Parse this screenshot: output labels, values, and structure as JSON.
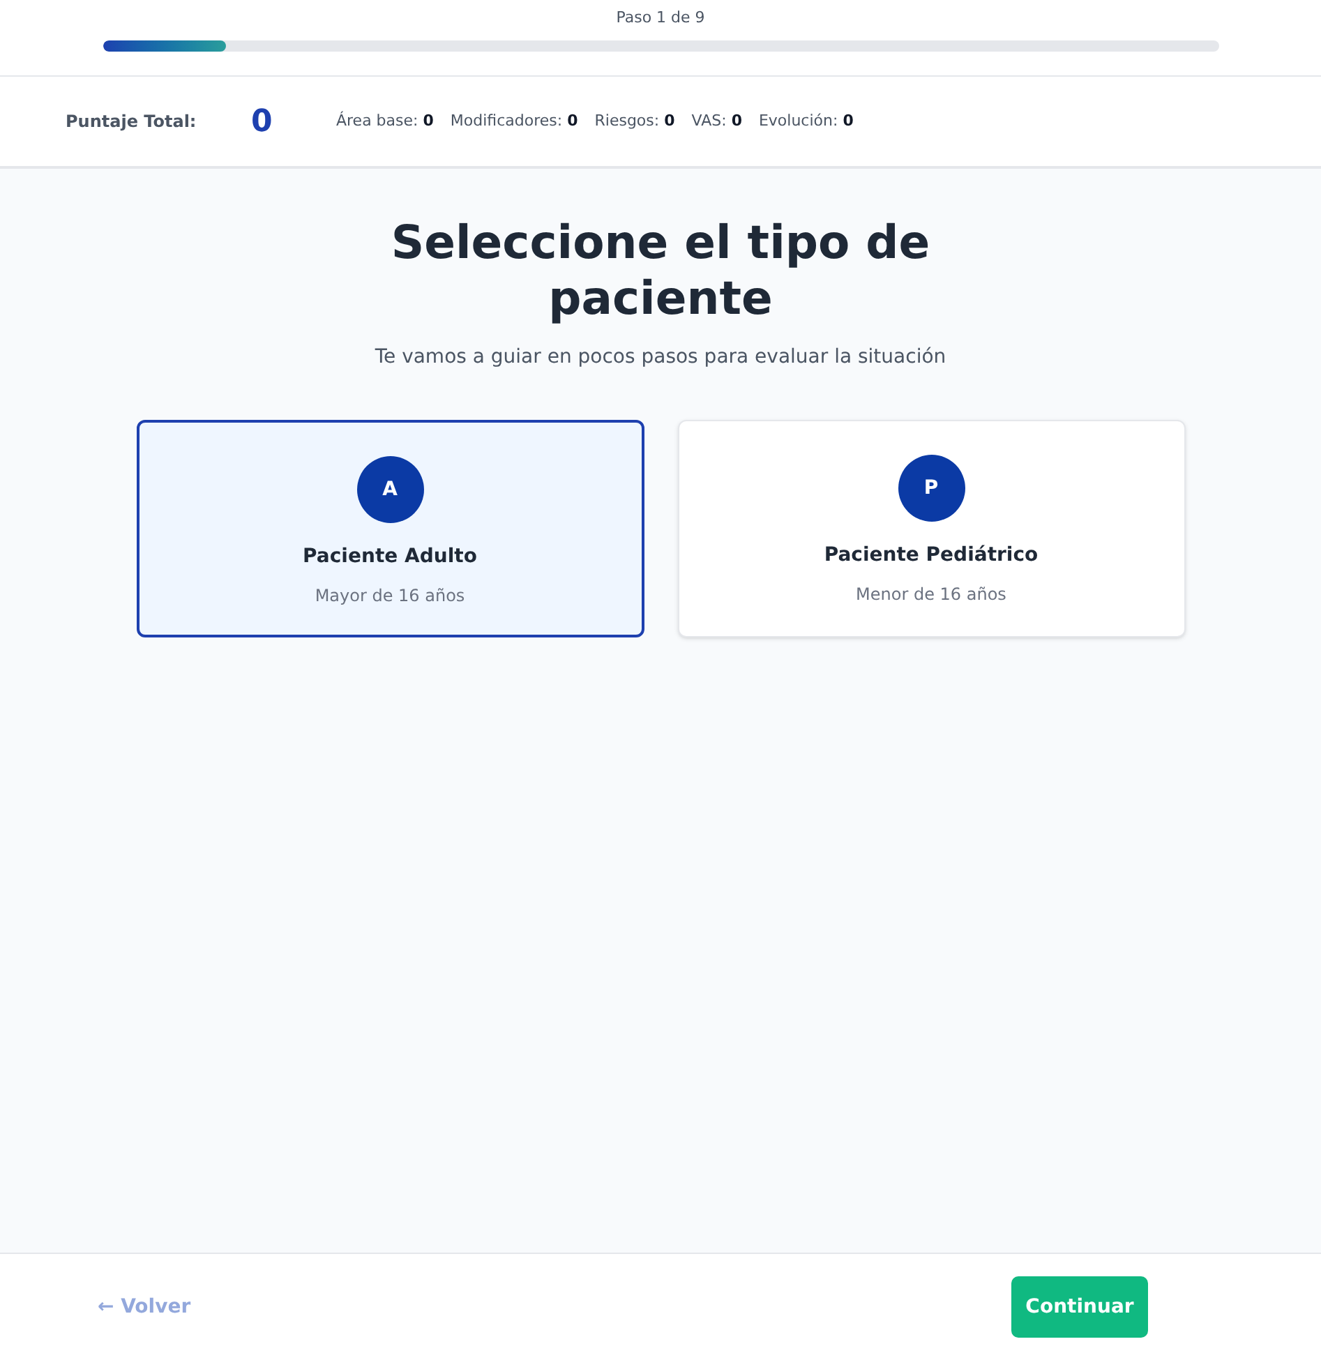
{
  "progress": {
    "label": "Paso 1 de 9",
    "level": 0.111
  },
  "score": {
    "label": "Puntaje Total:",
    "value": "0",
    "items": [
      {
        "label": "Área base:",
        "value": "0"
      },
      {
        "label": "Modificadores:",
        "value": "0"
      },
      {
        "label": "Riesgos:",
        "value": "0"
      },
      {
        "label": "VAS:",
        "value": "0"
      },
      {
        "label": "Evolución:",
        "value": "0"
      }
    ]
  },
  "title": "Seleccione el tipo de paciente",
  "subtitle": "Te vamos a guiar en pocos pasos para evaluar la situación",
  "options": [
    {
      "letter": "A",
      "title": "Paciente Adulto",
      "subtitle": "Mayor de 16 años",
      "selected": true
    },
    {
      "letter": "P",
      "title": "Paciente Pediátrico",
      "subtitle": "Menor de 16 años",
      "selected": false
    }
  ],
  "footer": {
    "back": {
      "label": "← Volver",
      "disabled": true
    },
    "next": {
      "label": "Continuar"
    }
  }
}
